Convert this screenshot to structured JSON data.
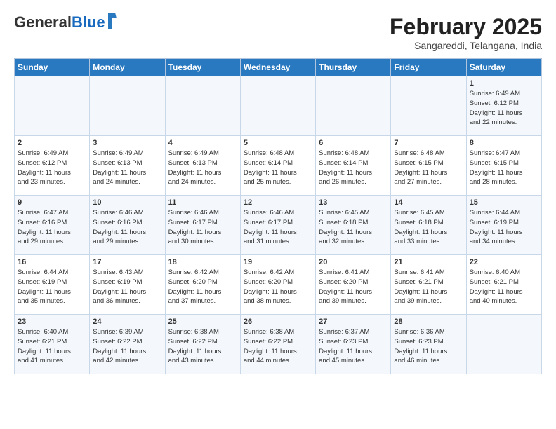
{
  "header": {
    "logo_general": "General",
    "logo_blue": "Blue",
    "month_title": "February 2025",
    "location": "Sangareddi, Telangana, India"
  },
  "days_of_week": [
    "Sunday",
    "Monday",
    "Tuesday",
    "Wednesday",
    "Thursday",
    "Friday",
    "Saturday"
  ],
  "weeks": [
    [
      {
        "day": "",
        "info": ""
      },
      {
        "day": "",
        "info": ""
      },
      {
        "day": "",
        "info": ""
      },
      {
        "day": "",
        "info": ""
      },
      {
        "day": "",
        "info": ""
      },
      {
        "day": "",
        "info": ""
      },
      {
        "day": "1",
        "info": "Sunrise: 6:49 AM\nSunset: 6:12 PM\nDaylight: 11 hours\nand 22 minutes."
      }
    ],
    [
      {
        "day": "2",
        "info": "Sunrise: 6:49 AM\nSunset: 6:12 PM\nDaylight: 11 hours\nand 23 minutes."
      },
      {
        "day": "3",
        "info": "Sunrise: 6:49 AM\nSunset: 6:13 PM\nDaylight: 11 hours\nand 24 minutes."
      },
      {
        "day": "4",
        "info": "Sunrise: 6:49 AM\nSunset: 6:13 PM\nDaylight: 11 hours\nand 24 minutes."
      },
      {
        "day": "5",
        "info": "Sunrise: 6:48 AM\nSunset: 6:14 PM\nDaylight: 11 hours\nand 25 minutes."
      },
      {
        "day": "6",
        "info": "Sunrise: 6:48 AM\nSunset: 6:14 PM\nDaylight: 11 hours\nand 26 minutes."
      },
      {
        "day": "7",
        "info": "Sunrise: 6:48 AM\nSunset: 6:15 PM\nDaylight: 11 hours\nand 27 minutes."
      },
      {
        "day": "8",
        "info": "Sunrise: 6:47 AM\nSunset: 6:15 PM\nDaylight: 11 hours\nand 28 minutes."
      }
    ],
    [
      {
        "day": "9",
        "info": "Sunrise: 6:47 AM\nSunset: 6:16 PM\nDaylight: 11 hours\nand 29 minutes."
      },
      {
        "day": "10",
        "info": "Sunrise: 6:46 AM\nSunset: 6:16 PM\nDaylight: 11 hours\nand 29 minutes."
      },
      {
        "day": "11",
        "info": "Sunrise: 6:46 AM\nSunset: 6:17 PM\nDaylight: 11 hours\nand 30 minutes."
      },
      {
        "day": "12",
        "info": "Sunrise: 6:46 AM\nSunset: 6:17 PM\nDaylight: 11 hours\nand 31 minutes."
      },
      {
        "day": "13",
        "info": "Sunrise: 6:45 AM\nSunset: 6:18 PM\nDaylight: 11 hours\nand 32 minutes."
      },
      {
        "day": "14",
        "info": "Sunrise: 6:45 AM\nSunset: 6:18 PM\nDaylight: 11 hours\nand 33 minutes."
      },
      {
        "day": "15",
        "info": "Sunrise: 6:44 AM\nSunset: 6:19 PM\nDaylight: 11 hours\nand 34 minutes."
      }
    ],
    [
      {
        "day": "16",
        "info": "Sunrise: 6:44 AM\nSunset: 6:19 PM\nDaylight: 11 hours\nand 35 minutes."
      },
      {
        "day": "17",
        "info": "Sunrise: 6:43 AM\nSunset: 6:19 PM\nDaylight: 11 hours\nand 36 minutes."
      },
      {
        "day": "18",
        "info": "Sunrise: 6:42 AM\nSunset: 6:20 PM\nDaylight: 11 hours\nand 37 minutes."
      },
      {
        "day": "19",
        "info": "Sunrise: 6:42 AM\nSunset: 6:20 PM\nDaylight: 11 hours\nand 38 minutes."
      },
      {
        "day": "20",
        "info": "Sunrise: 6:41 AM\nSunset: 6:20 PM\nDaylight: 11 hours\nand 39 minutes."
      },
      {
        "day": "21",
        "info": "Sunrise: 6:41 AM\nSunset: 6:21 PM\nDaylight: 11 hours\nand 39 minutes."
      },
      {
        "day": "22",
        "info": "Sunrise: 6:40 AM\nSunset: 6:21 PM\nDaylight: 11 hours\nand 40 minutes."
      }
    ],
    [
      {
        "day": "23",
        "info": "Sunrise: 6:40 AM\nSunset: 6:21 PM\nDaylight: 11 hours\nand 41 minutes."
      },
      {
        "day": "24",
        "info": "Sunrise: 6:39 AM\nSunset: 6:22 PM\nDaylight: 11 hours\nand 42 minutes."
      },
      {
        "day": "25",
        "info": "Sunrise: 6:38 AM\nSunset: 6:22 PM\nDaylight: 11 hours\nand 43 minutes."
      },
      {
        "day": "26",
        "info": "Sunrise: 6:38 AM\nSunset: 6:22 PM\nDaylight: 11 hours\nand 44 minutes."
      },
      {
        "day": "27",
        "info": "Sunrise: 6:37 AM\nSunset: 6:23 PM\nDaylight: 11 hours\nand 45 minutes."
      },
      {
        "day": "28",
        "info": "Sunrise: 6:36 AM\nSunset: 6:23 PM\nDaylight: 11 hours\nand 46 minutes."
      },
      {
        "day": "",
        "info": ""
      }
    ]
  ]
}
